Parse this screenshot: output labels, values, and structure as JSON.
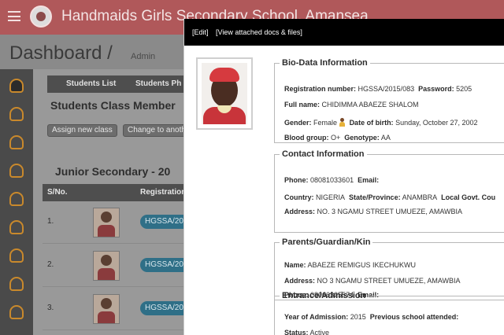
{
  "app": {
    "school_name": "Handmaids Girls Secondary School, Amanseа",
    "dashboard_title": "Dashboard /",
    "dashboard_sub": "Admin"
  },
  "sidebar": {
    "icons": [
      "user-icon",
      "users-icon",
      "users-icon",
      "users-icon",
      "users-icon",
      "documents-icon",
      "edit-icon",
      "list-icon",
      "graduation-icon"
    ]
  },
  "main": {
    "tabs": [
      "Students List",
      "Students Ph"
    ],
    "members_title": "Students Class Member",
    "assign_btn": "Assign new class",
    "change_btn": "Change to anothe",
    "class_title": "Junior Secondary - 20",
    "table_headers": [
      "S/No.",
      "Registration"
    ],
    "rows": [
      {
        "num": "1.",
        "reg": "HGSSA/201"
      },
      {
        "num": "2.",
        "reg": "HGSSA/201"
      },
      {
        "num": "3.",
        "reg": "HGSSA/201"
      }
    ]
  },
  "modal": {
    "edit_link": "[Edit]",
    "docs_link": "[View attached docs & files]",
    "biodata": {
      "title": "Bio-Data Information",
      "reg_label": "Registration number:",
      "reg_value": "HGSSA/2015/083",
      "password_label": "Password:",
      "password_value": "5205",
      "fullname_label": "Full name:",
      "fullname_value": "CHIDIMMA ABAEZE SHALOM",
      "gender_label": "Gender:",
      "gender_value": "Female",
      "dob_label": "Date of birth:",
      "dob_value": "Sunday, October 27, 2002",
      "blood_label": "Blood group:",
      "blood_value": "O+",
      "genotype_label": "Genotype:",
      "genotype_value": "AA"
    },
    "contact": {
      "title": "Contact Information",
      "phone_label": "Phone:",
      "phone_value": "08081033601",
      "email_label": "Email:",
      "country_label": "Country:",
      "country_value": "NIGERIA",
      "state_label": "State/Province:",
      "state_value": "ANAMBRA",
      "lga_label": "Local Govt. Cou",
      "address_label": "Address:",
      "address_value": "NO. 3 NGAMU STREET UMUEZE, AMAWBIA"
    },
    "parents": {
      "title": "Parents/Guardian/Kin",
      "name_label": "Name:",
      "name_value": "ABAEZE REMIGUS IKECHUKWU",
      "address_label": "Address:",
      "address_value": "NO 3 NGAMU STREET UMUEZE, AMAWBIA",
      "phone_label": "Phone:",
      "phone_value": "08066325574",
      "email_label": "Email:"
    },
    "admission": {
      "title": "Entrance/Admission",
      "year_label": "Year of Admission:",
      "year_value": "2015",
      "prev_label": "Previous school attended:",
      "status_label": "Status:",
      "status_value": "Active"
    }
  },
  "colors": {
    "topbar": "#b0585a",
    "modal_bar": "#000000",
    "sidebar_icon": "#c9892c",
    "reg_pill": "#2f6f87"
  }
}
